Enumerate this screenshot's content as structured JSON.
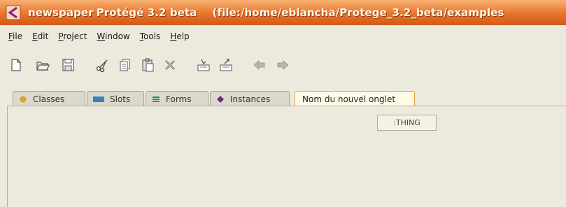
{
  "window": {
    "title_project": "newspaper",
    "title_app": "Protégé 3.2 beta",
    "title_file": "(file:/home/eblancha/Protege_3.2_beta/examples",
    "icon": "protege-logo-icon"
  },
  "menubar": {
    "items": [
      {
        "mnemonic": "F",
        "rest": "ile"
      },
      {
        "mnemonic": "E",
        "rest": "dit"
      },
      {
        "mnemonic": "P",
        "rest": "roject"
      },
      {
        "mnemonic": "W",
        "rest": "indow"
      },
      {
        "mnemonic": "T",
        "rest": "ools"
      },
      {
        "mnemonic": "H",
        "rest": "elp"
      }
    ]
  },
  "toolbar": {
    "icons": [
      "new-file-icon",
      "open-folder-icon",
      "save-icon",
      "cut-icon",
      "copy-icon",
      "paste-icon",
      "delete-icon",
      "import-icon",
      "export-icon",
      "undo-icon",
      "redo-icon"
    ]
  },
  "tabs": [
    {
      "label": "Classes",
      "icon": "classes-circle-icon",
      "color": "#e0a020"
    },
    {
      "label": "Slots",
      "icon": "slots-rect-icon",
      "color": "#3a7fc0"
    },
    {
      "label": "Forms",
      "icon": "forms-lines-icon",
      "color": "#2a9a3a"
    },
    {
      "label": "Instances",
      "icon": "instances-diamond-icon",
      "color": "#6a2a7a"
    },
    {
      "label": "Nom du nouvel onglet",
      "active": true
    }
  ],
  "content": {
    "node_label": ":THING"
  }
}
